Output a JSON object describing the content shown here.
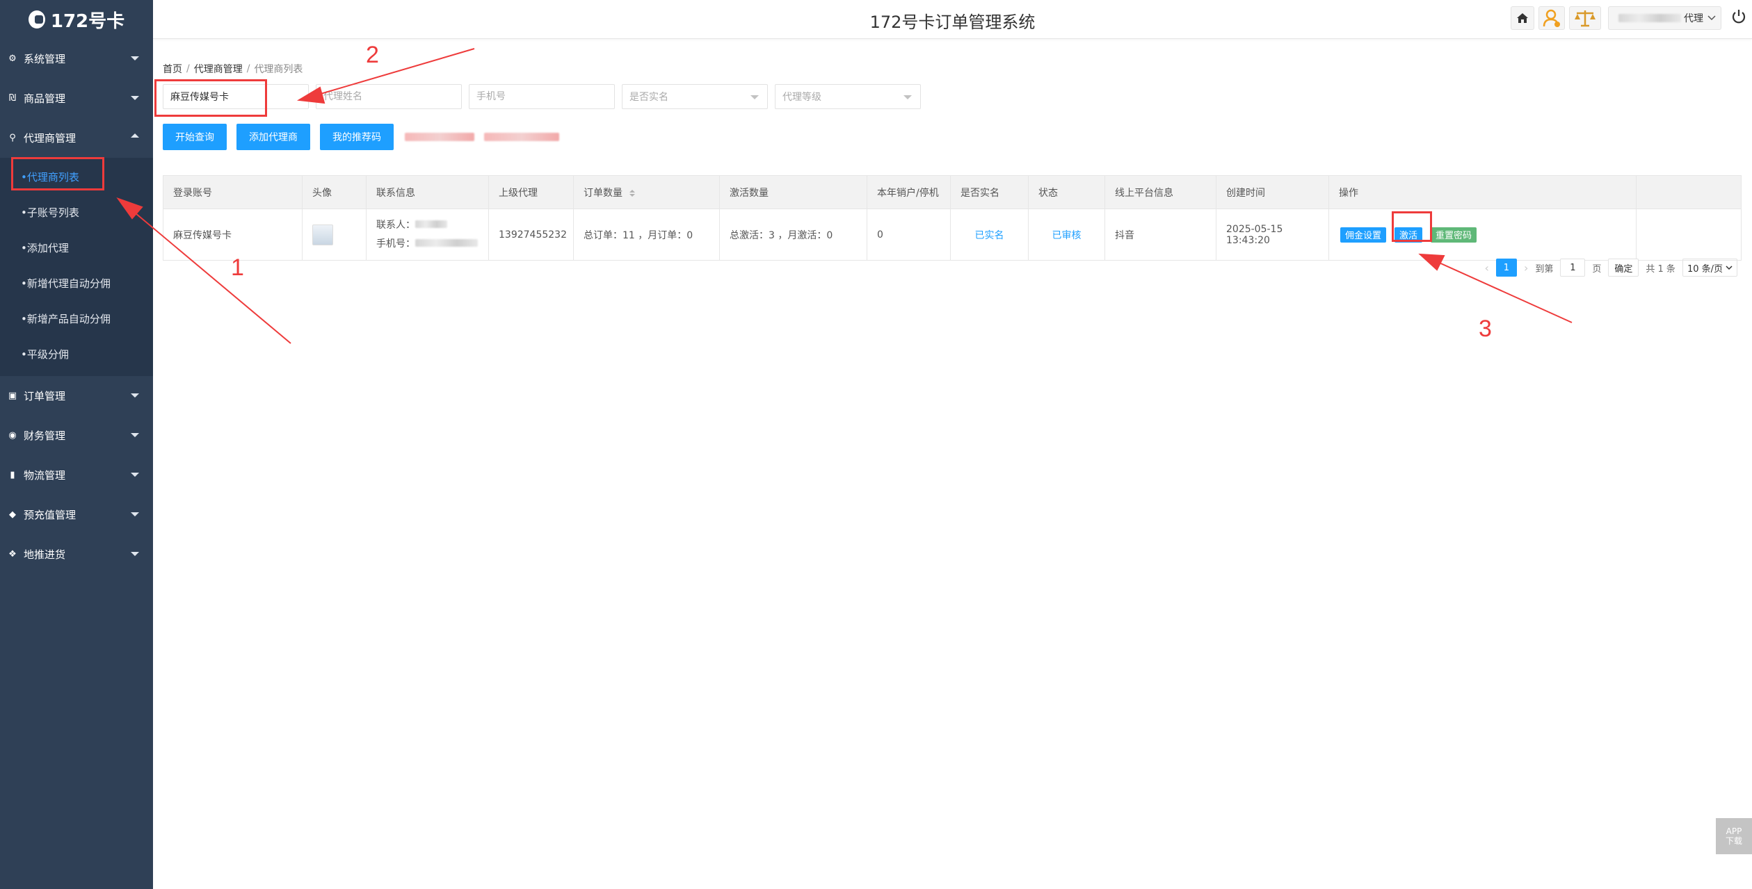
{
  "app": {
    "logo_text": "172号卡",
    "title": "172号卡订单管理系统"
  },
  "header": {
    "user_role": "代理"
  },
  "sidebar": {
    "items": [
      {
        "label": "系统管理",
        "icon": "gear-icon"
      },
      {
        "label": "商品管理",
        "icon": "goods-icon"
      },
      {
        "label": "代理商管理",
        "icon": "agent-icon",
        "open": true,
        "children": [
          {
            "label": "代理商列表",
            "active": true
          },
          {
            "label": "子账号列表"
          },
          {
            "label": "添加代理"
          },
          {
            "label": "新增代理自动分佣"
          },
          {
            "label": "新增产品自动分佣"
          },
          {
            "label": "平级分佣"
          }
        ]
      },
      {
        "label": "订单管理",
        "icon": "order-icon"
      },
      {
        "label": "财务管理",
        "icon": "finance-icon"
      },
      {
        "label": "物流管理",
        "icon": "bookmark-icon"
      },
      {
        "label": "预充值管理",
        "icon": "tag-icon"
      },
      {
        "label": "地推进货",
        "icon": "cluster-icon"
      }
    ]
  },
  "breadcrumb": {
    "home": "首页",
    "section": "代理商管理",
    "current": "代理商列表"
  },
  "filters": {
    "account_value": "麻豆传媒号卡",
    "name_placeholder": "代理姓名",
    "phone_placeholder": "手机号",
    "realname_placeholder": "是否实名",
    "level_placeholder": "代理等级"
  },
  "buttons": {
    "search": "开始查询",
    "add_agent": "添加代理商",
    "referral": "我的推荐码"
  },
  "table": {
    "headers": [
      "登录账号",
      "头像",
      "联系信息",
      "上级代理",
      "订单数量",
      "激活数量",
      "本年销户/停机",
      "是否实名",
      "状态",
      "线上平台信息",
      "创建时间",
      "操作"
    ],
    "rows": [
      {
        "account": "麻豆传媒号卡",
        "contact_label": "联系人：",
        "phone_label": "手机号：",
        "parent": "13927455232",
        "orders": "总订单：11 ，月订单：0",
        "activations": "总激活：3 ，月激活：0",
        "cancelled": "0",
        "realname": "已实名",
        "status": "已审核",
        "platform": "抖音",
        "created": "2025-05-15 13:43:20",
        "actions": {
          "commission": "佣金设置",
          "activate": "激活",
          "reset": "重置密码"
        }
      }
    ]
  },
  "pagination": {
    "current": "1",
    "goto_label": "到第",
    "page_input": "1",
    "page_unit": "页",
    "confirm": "确定",
    "total": "共 1 条",
    "per_page": "10 条/页"
  },
  "annotations": {
    "n1": "1",
    "n2": "2",
    "n3": "3"
  },
  "app_download": {
    "line1": "APP",
    "line2": "下载"
  },
  "colors": {
    "sidebar": "#2f4056",
    "primary": "#1e9fff",
    "success": "#5fb878",
    "annotation": "#ee3b3b"
  }
}
